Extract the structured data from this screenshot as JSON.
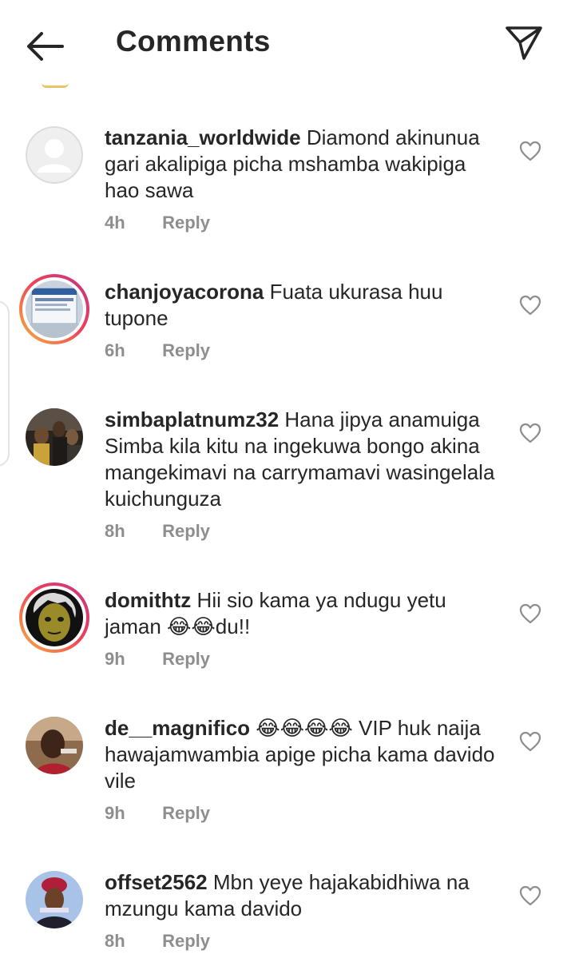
{
  "header": {
    "title": "Comments",
    "back_icon": "arrow-left-icon",
    "share_icon": "paper-plane-icon"
  },
  "comments": [
    {
      "username": "tanzania_worldwide",
      "text": "Diamond akinunua gari akalipiga picha mshamba wakipiga hao sawa",
      "time": "4h",
      "reply_label": "Reply",
      "avatar": "default-avatar",
      "story_ring": false
    },
    {
      "username": "chanjoyacorona",
      "text": "Fuata ukurasa huu tupone",
      "time": "6h",
      "reply_label": "Reply",
      "avatar": "vaccine-box-photo",
      "story_ring": true
    },
    {
      "username": "simbaplatnumz32",
      "text": "Hana jipya anamuiga Simba kila kitu na ingekuwa bongo akina mangekimavi na carrymamavi wasingelala kuichunguza",
      "time": "8h",
      "reply_label": "Reply",
      "avatar": "group-photo",
      "story_ring": false
    },
    {
      "username": "domithtz",
      "text": "Hii sio kama ya ndugu yetu jaman 😂😂du!!",
      "time": "9h",
      "reply_label": "Reply",
      "avatar": "painted-face-photo",
      "story_ring": true
    },
    {
      "username": "de__magnifico",
      "text": "😂😂😂😂 VIP huk naija hawajamwambia apige picha kama davido vile",
      "time": "9h",
      "reply_label": "Reply",
      "avatar": "portrait-photo",
      "story_ring": false
    },
    {
      "username": "offset2562",
      "text": "Mbn yeye hajakabidhiwa na mzungu kama davido",
      "time": "8h",
      "reply_label": "Reply",
      "avatar": "headwrap-portrait-photo",
      "story_ring": false
    }
  ],
  "like_icon": "heart-outline-icon",
  "colors": {
    "text": "#262626",
    "meta": "#8e8e8e",
    "story_ring_start": "#f7b33d",
    "story_ring_end": "#c13584"
  }
}
